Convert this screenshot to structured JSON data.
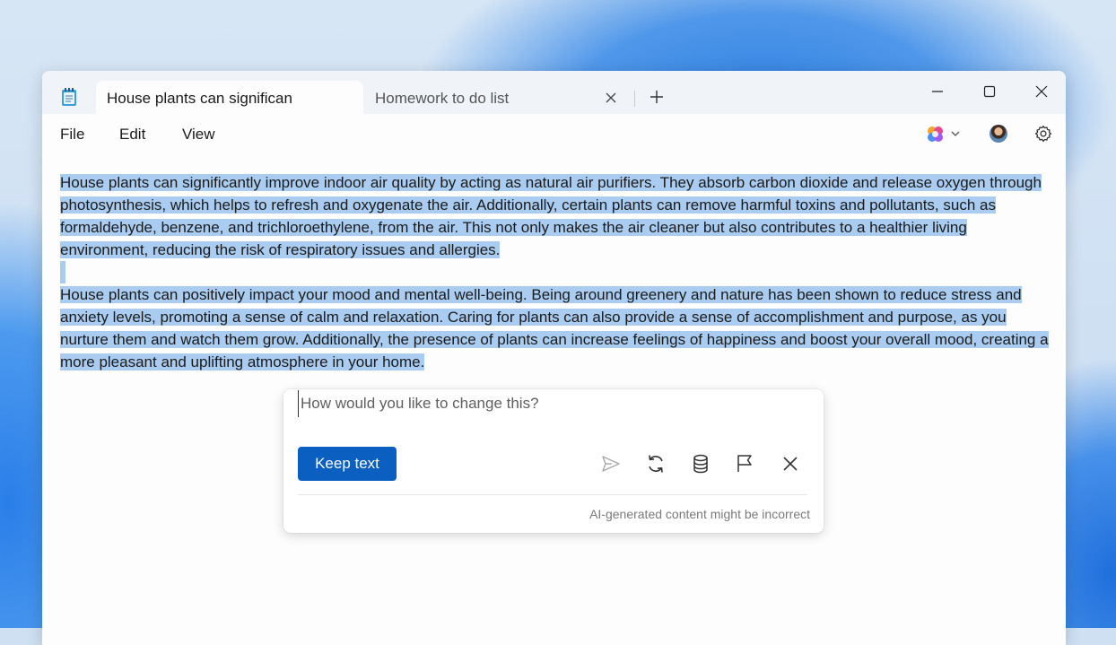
{
  "tabs": [
    {
      "label": "House plants can significan",
      "active": true
    },
    {
      "label": "Homework to do list",
      "active": false
    }
  ],
  "menu": {
    "file": "File",
    "edit": "Edit",
    "view": "View"
  },
  "document": {
    "paragraphs": [
      "House plants can significantly improve indoor air quality by acting as natural air purifiers. They absorb carbon dioxide and release oxygen through photosynthesis, which helps to refresh and oxygenate the air. Additionally, certain plants can remove harmful toxins and pollutants, such as formaldehyde, benzene, and trichloroethylene, from the air. This not only makes the air cleaner but also contributes to a healthier living environment, reducing the risk of respiratory issues and allergies.",
      "House plants can positively impact your mood and mental well-being. Being around greenery and nature has been shown to reduce stress and anxiety levels, promoting a sense of calm and relaxation. Caring for plants can also provide a sense of accomplishment and purpose, as you nurture them and watch them grow. Additionally, the presence of plants can increase feelings of happiness and boost your overall mood, creating a more pleasant and uplifting atmosphere in your home."
    ]
  },
  "rewrite_popup": {
    "placeholder": "How would you like to change this?",
    "keep_text_label": "Keep text",
    "disclaimer": "AI-generated content might be incorrect"
  },
  "icons": {
    "app": "notepad-icon",
    "copilot": "copilot-icon",
    "settings": "gear-icon",
    "send": "send-icon",
    "regenerate": "refresh-icon",
    "database": "database-icon",
    "flag": "flag-icon",
    "close": "close-icon"
  },
  "colors": {
    "selection": "#a9ccf0",
    "accent_button": "#0a5fc0"
  }
}
